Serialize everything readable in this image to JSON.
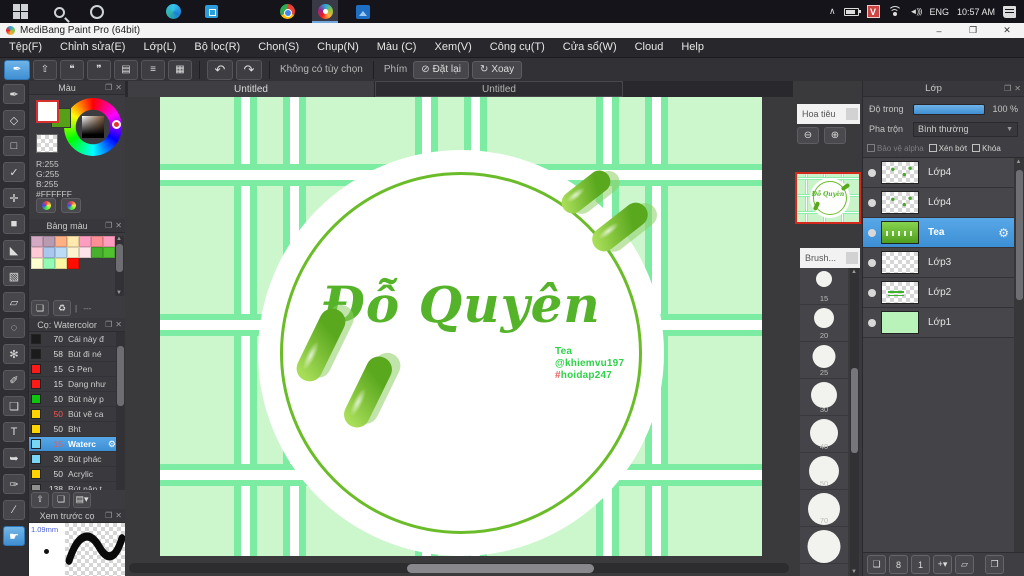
{
  "taskbar": {
    "time": "10:57 AM",
    "language": "ENG",
    "unikey_label": "V",
    "icons": [
      "start",
      "search",
      "cortana",
      "task-view",
      "edge",
      "store",
      "file-explorer",
      "chrome",
      "medibang",
      "photos"
    ],
    "active_icon": "medibang"
  },
  "titlebar": {
    "app_title": "MediBang Paint Pro (64bit)",
    "minimize": "–",
    "maximize": "❐",
    "close": "✕"
  },
  "menu": {
    "items": [
      "Tệp(F)",
      "Chỉnh sửa(E)",
      "Lớp(L)",
      "Bộ lọc(R)",
      "Chọn(S)",
      "Chụp(N)",
      "Màu (C)",
      "Xem(V)",
      "Công cụ(T)",
      "Cửa sổ(W)",
      "Cloud",
      "Help"
    ]
  },
  "toolbar": {
    "brush_glyph": "✒",
    "icons": [
      {
        "name": "share-button",
        "glyph": "⇧"
      },
      {
        "name": "comment-button",
        "glyph": "❝"
      },
      {
        "name": "material-button",
        "glyph": "❞"
      },
      {
        "name": "document-button",
        "glyph": "▤"
      },
      {
        "name": "list-settings-button",
        "glyph": "≡"
      },
      {
        "name": "grid-button",
        "glyph": "▦"
      }
    ],
    "undo_glyph": "↶",
    "redo_glyph": "↷",
    "no_option_label": "Không có tùy chọn",
    "key_label": "Phím",
    "reset_glyph": "⊘",
    "reset_label": "Đặt lại",
    "rotate_glyph": "↻",
    "rotate_label": "Xoay"
  },
  "tabs": [
    {
      "label": "Untitled",
      "active": true
    },
    {
      "label": "Untitled",
      "active": false
    }
  ],
  "tools": [
    {
      "name": "brush-tool",
      "glyph": "✒"
    },
    {
      "name": "eraser-tool",
      "glyph": "◇"
    },
    {
      "name": "figure-tool",
      "glyph": "□"
    },
    {
      "name": "snap-tool",
      "glyph": "✓"
    },
    {
      "name": "move-tool",
      "glyph": "✛"
    },
    {
      "name": "fill-rect-tool",
      "glyph": "■"
    },
    {
      "name": "bucket-tool",
      "glyph": "◣"
    },
    {
      "name": "gradient-tool",
      "glyph": "▧"
    },
    {
      "name": "select-tool",
      "glyph": "▱"
    },
    {
      "name": "lasso-tool",
      "glyph": "◌"
    },
    {
      "name": "magic-wand-tool",
      "glyph": "✻"
    },
    {
      "name": "select-pen-tool",
      "glyph": "✐"
    },
    {
      "name": "select-eraser-tool",
      "glyph": "❏"
    },
    {
      "name": "text-tool",
      "glyph": "T"
    },
    {
      "name": "operation-tool",
      "glyph": "➥"
    },
    {
      "name": "eyedropper-tool",
      "glyph": "✑"
    },
    {
      "name": "divide-tool",
      "glyph": "∕"
    },
    {
      "name": "hand-tool",
      "glyph": "☛",
      "active": true
    }
  ],
  "color_panel": {
    "title": "Màu",
    "r_label": "R:255",
    "g_label": "G:255",
    "b_label": "B:255",
    "hex_label": "#FFFFFF",
    "foreground_color": "#FFFFFF",
    "background_color": "#55a017"
  },
  "palette_panel": {
    "title": "Bảng màu",
    "empty_label": "---",
    "rows": [
      [
        "#d4a9c4",
        "#b89bb0",
        "#ffb184",
        "#ffe9ad",
        "#ff9dc0",
        "#ff8f96",
        "#ff9dc0"
      ],
      [
        "#ffc9d6",
        "#a9c6ee",
        "#bcdcf5",
        "#fdf3cf",
        "#ffe3ea",
        "#47b02c",
        "#52c12f"
      ],
      [
        "#ffffd0",
        "#93fab4",
        "#fdf6a3",
        "#ff0d00"
      ]
    ]
  },
  "brush_panel": {
    "title": "Cọ: Watercolor",
    "brushes": [
      {
        "swatch": "#1b1b1b",
        "size": "70",
        "name": "Cái này đ",
        "size_red": false,
        "selected": false
      },
      {
        "swatch": "#1b1b1b",
        "size": "58",
        "name": "Bút đi né",
        "size_red": false,
        "selected": false
      },
      {
        "swatch": "#ff1a1a",
        "size": "15",
        "name": "G Pen",
        "size_red": false,
        "selected": false
      },
      {
        "swatch": "#ff1a1a",
        "size": "15",
        "name": "Dạng như",
        "size_red": false,
        "selected": false
      },
      {
        "swatch": "#0fc50f",
        "size": "10",
        "name": "Bút này p",
        "size_red": false,
        "selected": false
      },
      {
        "swatch": "#ffd400",
        "size": "50",
        "name": "Bút vẽ ca",
        "size_red": true,
        "selected": false
      },
      {
        "swatch": "#ffd400",
        "size": "50",
        "name": "Bht",
        "size_red": false,
        "selected": false
      },
      {
        "swatch": "#79d7f5",
        "size": "15",
        "name": "Waterc",
        "size_red": true,
        "selected": true
      },
      {
        "swatch": "#79d7f5",
        "size": "30",
        "name": "Bút phác",
        "size_red": false,
        "selected": false
      },
      {
        "swatch": "#ffd400",
        "size": "50",
        "name": "Acrylic",
        "size_red": false,
        "selected": false
      },
      {
        "swatch": "#8f8f8f",
        "size": "138",
        "name": "Bút nân t",
        "size_red": false,
        "selected": false
      }
    ],
    "buttons": [
      {
        "name": "brush-download-button",
        "glyph": "⇧"
      },
      {
        "name": "brush-add-button",
        "glyph": "❏"
      },
      {
        "name": "brush-menu-button",
        "glyph": "▤▾"
      }
    ]
  },
  "preview_panel": {
    "title": "Xem trước cọ",
    "brush_size": "1.09mm"
  },
  "navigator": {
    "title": "Hoa tiêu",
    "zoom_out_glyph": "⊖",
    "zoom_in_glyph": "⊕"
  },
  "brush_sizes": {
    "title": "Brush...",
    "items": [
      {
        "label": "15",
        "d": 16
      },
      {
        "label": "20",
        "d": 20
      },
      {
        "label": "25",
        "d": 23
      },
      {
        "label": "30",
        "d": 26
      },
      {
        "label": "40",
        "d": 28
      },
      {
        "label": "50",
        "d": 30
      },
      {
        "label": "70",
        "d": 32
      },
      {
        "label": "",
        "d": 33
      }
    ]
  },
  "layers_panel": {
    "title": "Lớp",
    "opacity_label": "Độ trong",
    "opacity_value": "100 %",
    "blend_label": "Pha trộn",
    "blend_value": "Bình thường",
    "checkboxes": [
      {
        "label": "Bảo vệ alpha",
        "disabled": true
      },
      {
        "label": "Xén bớt",
        "disabled": false
      },
      {
        "label": "Khóa",
        "disabled": false
      }
    ],
    "layers": [
      {
        "name": "Lớp4",
        "thumb": "dots",
        "selected": false
      },
      {
        "name": "Lớp4",
        "thumb": "dots",
        "selected": false
      },
      {
        "name": "Tea",
        "thumb": "tea",
        "selected": true
      },
      {
        "name": "Lớp3",
        "thumb": "empty",
        "selected": false
      },
      {
        "name": "Lớp2",
        "thumb": "mini-text",
        "selected": false
      },
      {
        "name": "Lớp1",
        "thumb": "solid",
        "selected": false
      }
    ],
    "buttons": [
      {
        "name": "new-layer-button",
        "glyph": "❏"
      },
      {
        "name": "new-8bit-layer-button",
        "glyph": "8"
      },
      {
        "name": "new-1bit-layer-button",
        "glyph": "1"
      },
      {
        "name": "add-layer-button",
        "glyph": "+▾"
      },
      {
        "name": "layer-folder-button",
        "glyph": "▱"
      },
      {
        "name": "duplicate-layer-button",
        "glyph": "❐"
      }
    ]
  },
  "canvas": {
    "label_text": "Đỗ Quyên",
    "credit_line1": "Tea",
    "credit_line2": "@khiemvu197",
    "credit_line3_hash": "#",
    "credit_line3_rest": "hoidap247",
    "mini_label": "Đỗ Quyên"
  },
  "colors": {
    "selection_blue": "#4a9ddb",
    "canvas_base": "#ccf6cc",
    "plaid_green": "#7ceca2",
    "ring_green": "#6abc29",
    "label_green": "#55b32a",
    "leaf_green": "#5aa81e",
    "credit_green": "#2fd24a",
    "credit_hash_red": "#e85d5d",
    "navigator_border_red": "#d42a1e",
    "unikey_red": "#cc4444"
  }
}
